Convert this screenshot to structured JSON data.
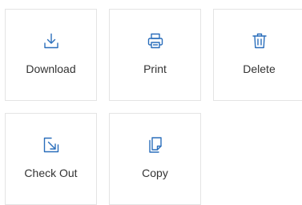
{
  "accent_color": "#2a6ebb",
  "actions": [
    {
      "label": "Download",
      "icon": "download-icon"
    },
    {
      "label": "Print",
      "icon": "printer-icon"
    },
    {
      "label": "Delete",
      "icon": "trash-icon"
    },
    {
      "label": "Check Out",
      "icon": "check-out-icon"
    },
    {
      "label": "Copy",
      "icon": "copy-icon"
    }
  ]
}
